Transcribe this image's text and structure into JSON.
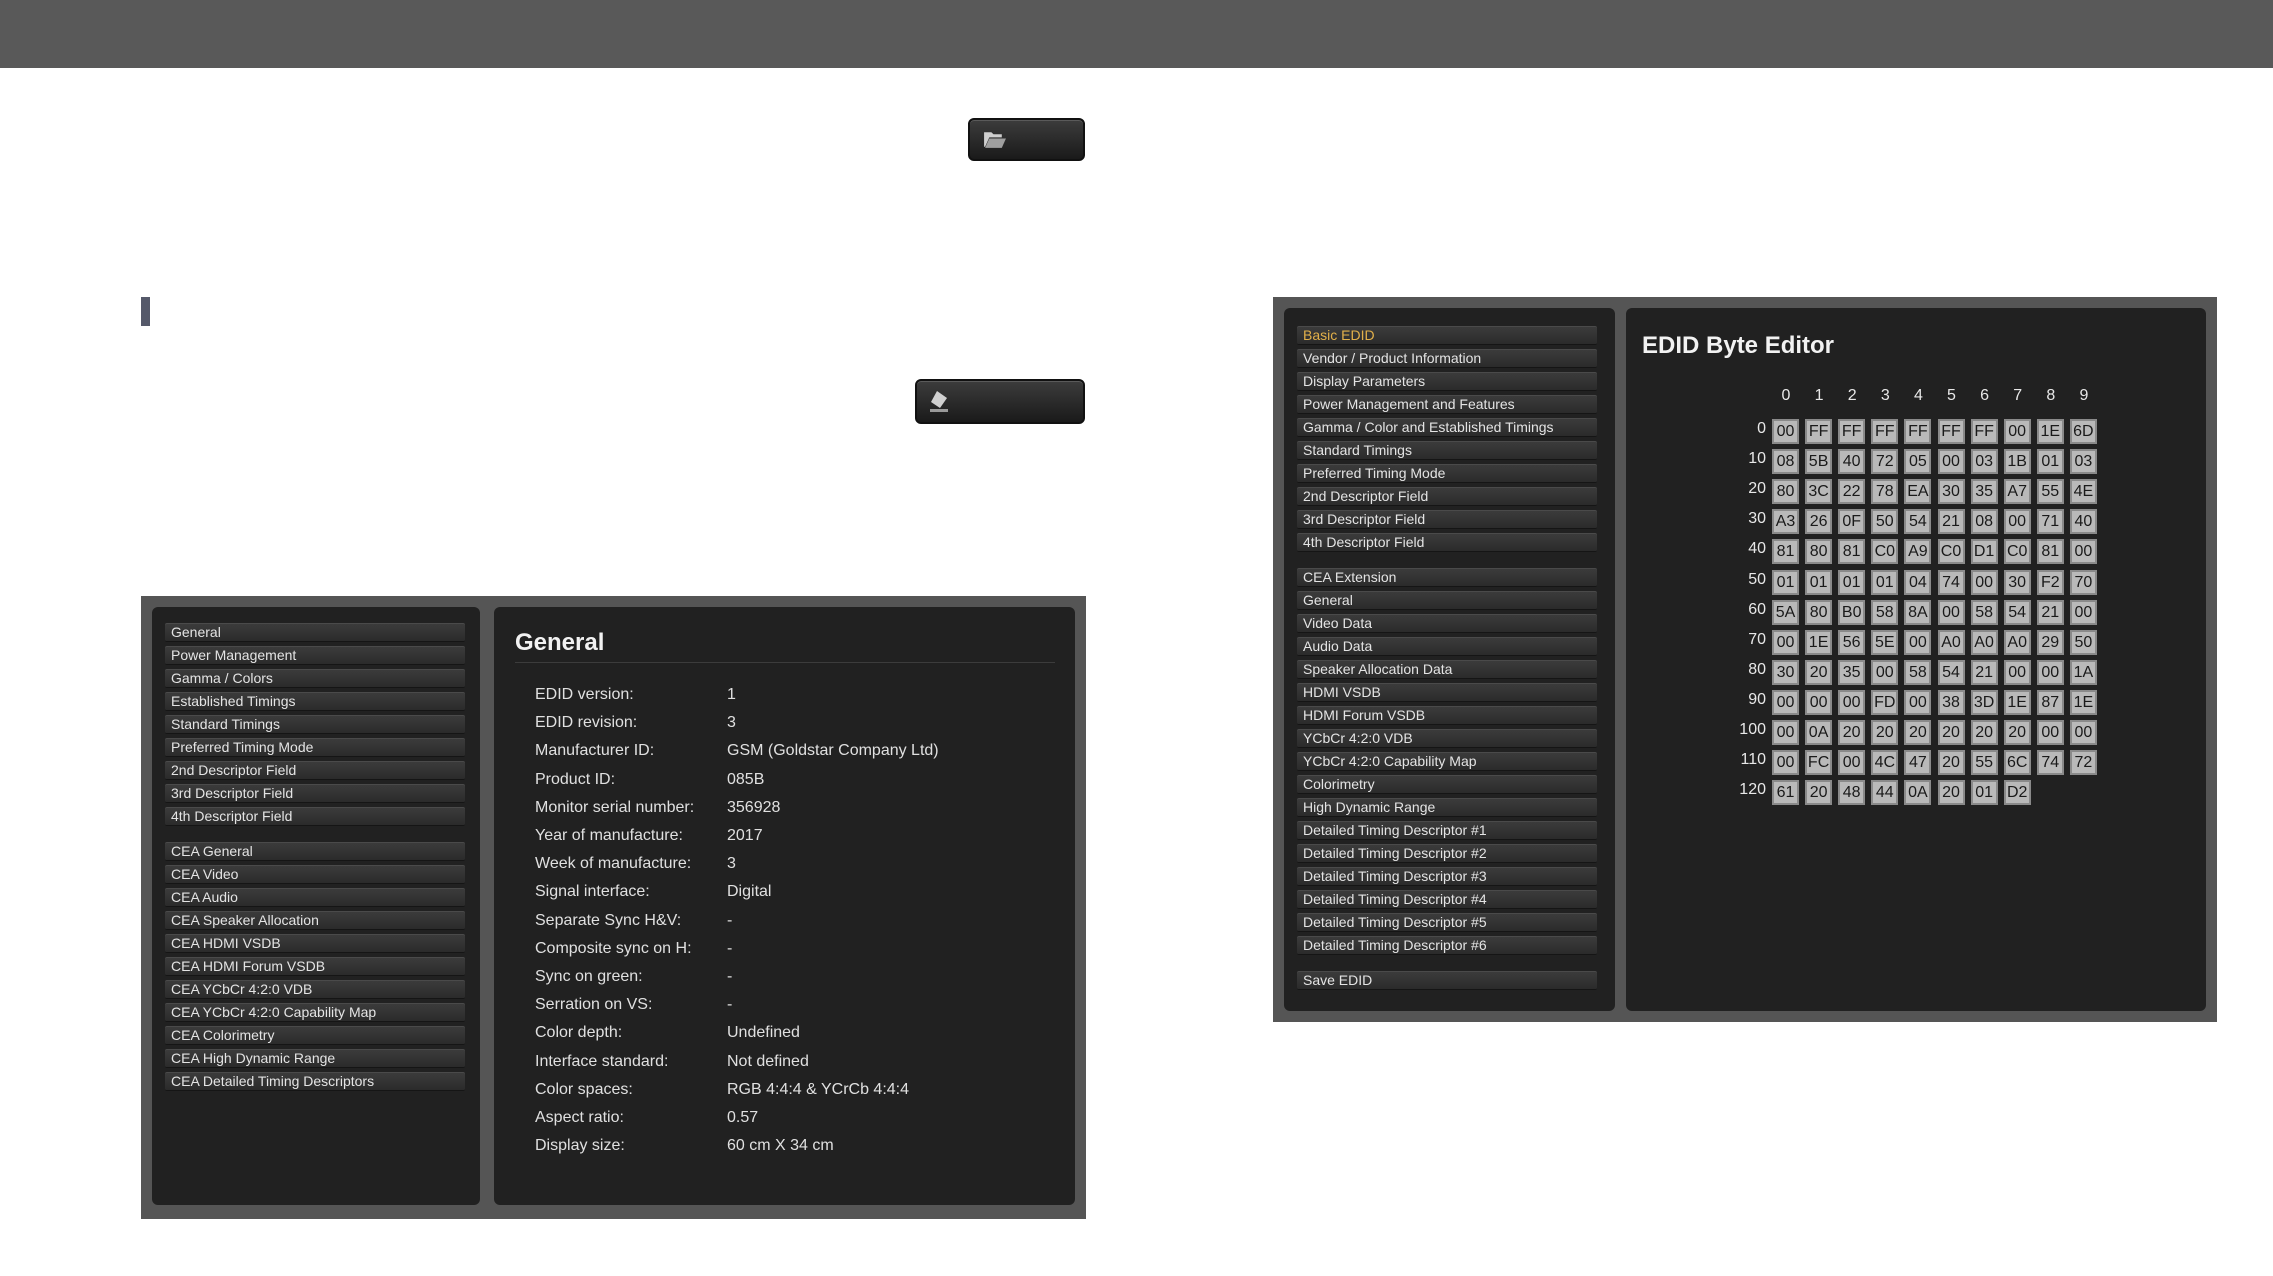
{
  "left_panel": {
    "nav_group1": [
      "General",
      "Power Management",
      "Gamma / Colors",
      "Established Timings",
      "Standard Timings",
      "Preferred Timing Mode",
      "2nd Descriptor Field",
      "3rd Descriptor Field",
      "4th Descriptor Field"
    ],
    "nav_group2": [
      "CEA General",
      "CEA Video",
      "CEA Audio",
      "CEA Speaker Allocation",
      "CEA HDMI VSDB",
      "CEA HDMI Forum VSDB",
      "CEA YCbCr 4:2:0 VDB",
      "CEA YCbCr 4:2:0 Capability Map",
      "CEA Colorimetry",
      "CEA High Dynamic Range",
      "CEA Detailed Timing Descriptors"
    ],
    "title": "General",
    "fields": [
      {
        "label": "EDID version:",
        "value": "1"
      },
      {
        "label": "EDID revision:",
        "value": "3"
      },
      {
        "label": "Manufacturer ID:",
        "value": "GSM (Goldstar Company Ltd)"
      },
      {
        "label": "Product ID:",
        "value": "085B"
      },
      {
        "label": "Monitor serial number:",
        "value": "356928"
      },
      {
        "label": "Year of manufacture:",
        "value": "2017"
      },
      {
        "label": "Week of manufacture:",
        "value": "3"
      },
      {
        "label": "Signal interface:",
        "value": "Digital"
      },
      {
        "label": "Separate Sync H&V:",
        "value": "-"
      },
      {
        "label": "Composite sync on H:",
        "value": "-"
      },
      {
        "label": "Sync on green:",
        "value": "-"
      },
      {
        "label": "Serration on VS:",
        "value": "-"
      },
      {
        "label": "Color depth:",
        "value": "Undefined"
      },
      {
        "label": "Interface standard:",
        "value": "Not defined"
      },
      {
        "label": "Color spaces:",
        "value": "RGB 4:4:4 & YCrCb 4:4:4"
      },
      {
        "label": "Aspect ratio:",
        "value": "0.57"
      },
      {
        "label": "Display size:",
        "value": "60 cm X 34 cm"
      }
    ]
  },
  "right_panel": {
    "nav_group1": [
      "Basic EDID",
      "Vendor / Product Information",
      "Display Parameters",
      "Power Management and Features",
      "Gamma / Color and Established Timings",
      "Standard Timings",
      "Preferred Timing Mode",
      "2nd Descriptor Field",
      "3rd Descriptor Field",
      "4th Descriptor Field"
    ],
    "nav_group2": [
      "CEA Extension",
      "General",
      "Video Data",
      "Audio Data",
      "Speaker Allocation Data",
      "HDMI VSDB",
      "HDMI Forum VSDB",
      "YCbCr 4:2:0 VDB",
      "YCbCr 4:2:0 Capability Map",
      "Colorimetry",
      "High Dynamic Range",
      "Detailed Timing Descriptor #1",
      "Detailed Timing Descriptor #2",
      "Detailed Timing Descriptor #3",
      "Detailed Timing Descriptor #4",
      "Detailed Timing Descriptor #5",
      "Detailed Timing Descriptor #6"
    ],
    "save_label": "Save EDID",
    "active_item": "Basic EDID",
    "active_color": "#e2b04a",
    "title": "EDID Byte Editor",
    "col_headers": [
      "0",
      "1",
      "2",
      "3",
      "4",
      "5",
      "6",
      "7",
      "8",
      "9"
    ],
    "row_headers": [
      "0",
      "10",
      "20",
      "30",
      "40",
      "50",
      "60",
      "70",
      "80",
      "90",
      "100",
      "110",
      "120"
    ],
    "bytes": [
      [
        "00",
        "FF",
        "FF",
        "FF",
        "FF",
        "FF",
        "FF",
        "00",
        "1E",
        "6D"
      ],
      [
        "08",
        "5B",
        "40",
        "72",
        "05",
        "00",
        "03",
        "1B",
        "01",
        "03"
      ],
      [
        "80",
        "3C",
        "22",
        "78",
        "EA",
        "30",
        "35",
        "A7",
        "55",
        "4E"
      ],
      [
        "A3",
        "26",
        "0F",
        "50",
        "54",
        "21",
        "08",
        "00",
        "71",
        "40"
      ],
      [
        "81",
        "80",
        "81",
        "C0",
        "A9",
        "C0",
        "D1",
        "C0",
        "81",
        "00"
      ],
      [
        "01",
        "01",
        "01",
        "01",
        "04",
        "74",
        "00",
        "30",
        "F2",
        "70"
      ],
      [
        "5A",
        "80",
        "B0",
        "58",
        "8A",
        "00",
        "58",
        "54",
        "21",
        "00"
      ],
      [
        "00",
        "1E",
        "56",
        "5E",
        "00",
        "A0",
        "A0",
        "A0",
        "29",
        "50"
      ],
      [
        "30",
        "20",
        "35",
        "00",
        "58",
        "54",
        "21",
        "00",
        "00",
        "1A"
      ],
      [
        "00",
        "00",
        "00",
        "FD",
        "00",
        "38",
        "3D",
        "1E",
        "87",
        "1E"
      ],
      [
        "00",
        "0A",
        "20",
        "20",
        "20",
        "20",
        "20",
        "20",
        "00",
        "00"
      ],
      [
        "00",
        "FC",
        "00",
        "4C",
        "47",
        "20",
        "55",
        "6C",
        "74",
        "72"
      ],
      [
        "61",
        "20",
        "48",
        "44",
        "0A",
        "20",
        "01",
        "D2"
      ]
    ]
  },
  "icons": {
    "open_button": "folder-open-icon",
    "clear_button": "eraser-icon"
  }
}
